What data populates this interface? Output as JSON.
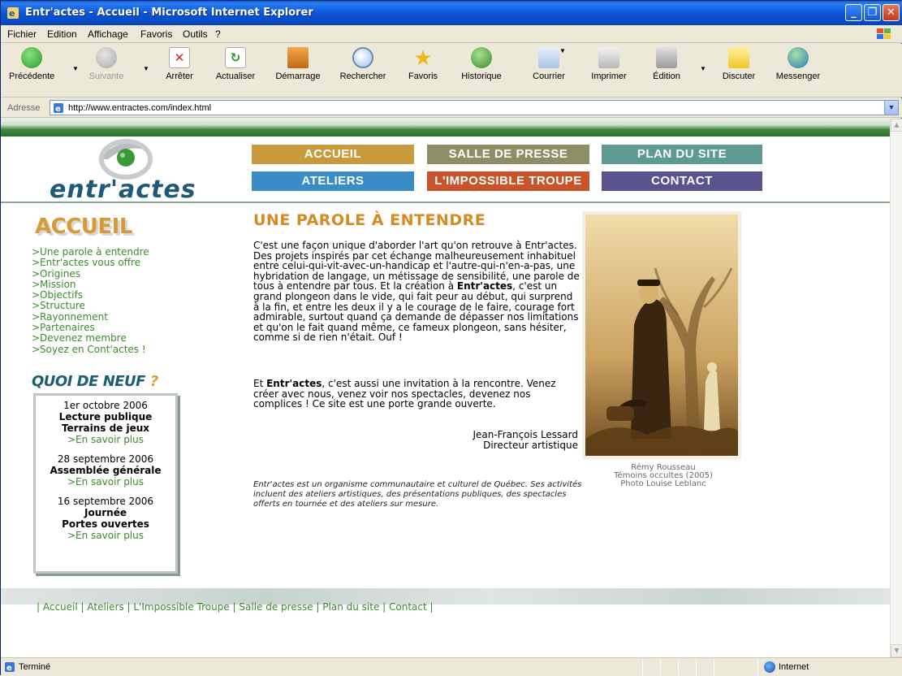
{
  "window": {
    "title": "Entr'actes - Accueil - Microsoft Internet Explorer",
    "min_label": "_",
    "max_label": "❐",
    "close_label": "✕"
  },
  "menu": [
    "Fichier",
    "Edition",
    "Affichage",
    "Favoris",
    "Outils",
    "?"
  ],
  "toolbar": {
    "back": "Précédente",
    "forward": "Suivante",
    "stop": "Arrêter",
    "refresh": "Actualiser",
    "home": "Démarrage",
    "search": "Rechercher",
    "favorites": "Favoris",
    "history": "Historique",
    "mail": "Courrier",
    "print": "Imprimer",
    "edit": "Édition",
    "discuss": "Discuter",
    "messenger": "Messenger"
  },
  "address": {
    "label": "Adresse",
    "url": "http://www.entractes.com/index.html"
  },
  "site": {
    "logo_text": "entr'actes",
    "nav": [
      "ACCUEIL",
      "SALLE DE PRESSE",
      "PLAN DU SITE",
      "ATELIERS",
      "L'IMPOSSIBLE TROUPE",
      "CONTACT"
    ],
    "nav_colors": [
      "#c79a3e",
      "#8e8e66",
      "#5e9a92",
      "#3a8cc4",
      "#c9542a",
      "#5a548e"
    ],
    "section_title": "ACCUEIL",
    "left_links": [
      ">Une parole à entendre",
      ">Entr'actes vous offre",
      ">Origines",
      ">Mission",
      ">Objectifs",
      ">Structure",
      ">Rayonnement",
      ">Partenaires",
      ">Devenez membre",
      ">Soyez en Cont'actes !"
    ],
    "news_title": "QUOI DE NEUF",
    "news_q": "?",
    "news": [
      {
        "date": "1er octobre 2006",
        "title": "Lecture publique\nTerrains de jeux",
        "link": ">En savoir plus"
      },
      {
        "date": "28 septembre 2006",
        "title": "Assemblée générale",
        "link": ">En savoir plus"
      },
      {
        "date": "16 septembre 2006",
        "title": "Journée\nPortes ouvertes",
        "link": ">En savoir plus"
      }
    ],
    "main_title": "UNE PAROLE À ENTENDRE",
    "p1_a": "C'est une façon unique d'aborder l'art qu'on retrouve à Entr'actes. Des projets inspirés par cet échange malheureusement inhabituel entre celui-qui-vit-avec-un-handicap et l'autre-qui-n'en-a-pas, une hybridation de langage, un métissage de sensibilité, une parole de tous à entendre par tous. Et la création à ",
    "p1_b": "Entr'actes",
    "p1_c": ", c'est un grand plongeon dans le vide, qui fait peur au début, qui surprend à la fin, et entre les deux il y a le courage de le faire, courage fort admirable, surtout quand ça demande de dépasser nos limitations et qu'on le fait quand même, ce fameux plongeon, sans hésiter, comme si de rien n'était. Ouf !",
    "p2_a": "Et ",
    "p2_b": "Entr'actes",
    "p2_c": ", c'est aussi une invitation à la rencontre. Venez créer avec nous, venez voir nos spectacles, devenez nos complices ! Ce site est une porte grande ouverte.",
    "sig_name": "Jean-François Lessard",
    "sig_role": "Directeur artistique",
    "italic_note": "Entr'actes est un organisme communautaire et culturel de Québec. Ses activités incluent des ateliers artistiques, des présentations publiques, des spectacles offerts en tournée et des ateliers sur mesure.",
    "caption": [
      "Rémy Rousseau",
      "Témoins occultes (2005)",
      "Photo Louise Leblanc"
    ],
    "footer": "| Accueil | Ateliers | L'Impossible Troupe | Salle de presse | Plan du site | Contact |"
  },
  "status": {
    "text": "Terminé",
    "zone": "Internet"
  }
}
